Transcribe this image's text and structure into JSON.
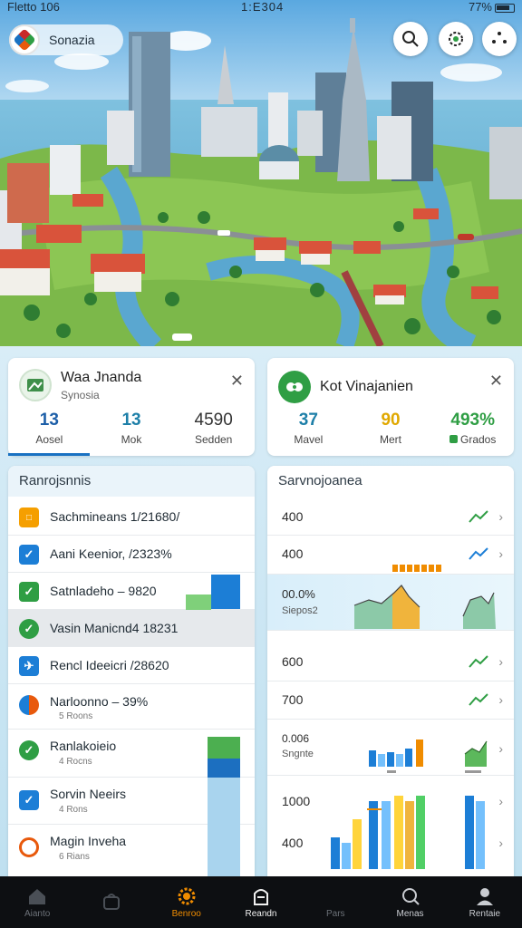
{
  "status_bar": {
    "left": "Fletto 106",
    "center": "1:E304",
    "right": "77%"
  },
  "app": {
    "title": "Sonazia",
    "logo_icon": "app-logo-icon"
  },
  "top_buttons": [
    {
      "name": "search-button",
      "icon": "search-icon"
    },
    {
      "name": "settings-button",
      "icon": "gear-icon"
    },
    {
      "name": "more-button",
      "icon": "dots-icon"
    }
  ],
  "card_left": {
    "name": "Waa Jnanda",
    "sub": "Synosia",
    "stats": [
      {
        "value": "13",
        "label": "Aosel",
        "color": "#1d5fa8"
      },
      {
        "value": "13",
        "label": "Mok",
        "color": "#1d7fa8"
      },
      {
        "value": "4590",
        "label": "Sedden",
        "color": "#333333"
      }
    ]
  },
  "card_right": {
    "name": "Kot Vinajanien",
    "stats": [
      {
        "value": "37",
        "label": "Mavel",
        "color": "#1d7fa8"
      },
      {
        "value": "90",
        "label": "Mert",
        "color": "#e0a800"
      },
      {
        "value": "493%",
        "label": "Grados",
        "color": "#2f9e44"
      }
    ]
  },
  "list_left": {
    "header": "Ranrojsnnis",
    "items": [
      {
        "text": "Sachmineans 1/21680/",
        "sub": "",
        "icon": "folder-icon",
        "color": "#f59f00"
      },
      {
        "text": "Aani Keenior, /2323%",
        "sub": "",
        "icon": "check-icon",
        "color": "#1c7ed6"
      },
      {
        "text": "Satnladeho – 9820",
        "sub": "",
        "icon": "check-icon",
        "color": "#2f9e44"
      },
      {
        "text": "Vasin Manicnd4 18231",
        "sub": "",
        "icon": "check-badge-icon",
        "color": "#2f9e44"
      },
      {
        "text": "Rencl Ideeicri /28620",
        "sub": "",
        "icon": "plane-icon",
        "color": "#1c7ed6"
      },
      {
        "text": "Narloonno – 39%",
        "sub": "5 Roons",
        "icon": "globe-icon",
        "color": "#e8590c"
      },
      {
        "text": "Ranlakoieio",
        "sub": "4 Rocns",
        "icon": "check-badge-icon",
        "color": "#2f9e44"
      },
      {
        "text": "Sorvin Neeirs",
        "sub": "4 Rons",
        "icon": "check-icon",
        "color": "#1c7ed6"
      },
      {
        "text": "Magin Inveha",
        "sub": "6 Rians",
        "icon": "circle-icon",
        "color": "#e8590c"
      }
    ]
  },
  "list_right": {
    "header": "Sarvnojoanea",
    "rows": [
      {
        "value": "400",
        "trend": "up"
      },
      {
        "value": "400",
        "trend": "up"
      },
      {
        "value": "600",
        "trend": "up"
      },
      {
        "value": "700",
        "trend": "up"
      },
      {
        "value": "1000",
        "trend": "none"
      },
      {
        "value": "400",
        "trend": "none"
      }
    ],
    "highlight": {
      "value": "00.0%",
      "sub": "Siepos2"
    },
    "chart_block": {
      "value": "0.006",
      "sub": "Sngnte"
    }
  },
  "bottom_nav": [
    {
      "label": "Aianto",
      "icon": "home-icon"
    },
    {
      "label": "",
      "icon": "bag-icon"
    },
    {
      "label": "Benroo",
      "icon": "gear-orange-icon"
    },
    {
      "label": "Reandn",
      "icon": "doc-icon"
    },
    {
      "label": "Pars",
      "icon": "blank-icon"
    },
    {
      "label": "Menas",
      "icon": "chat-icon"
    },
    {
      "label": "Rentaie",
      "icon": "person-icon"
    }
  ],
  "colors": {
    "accent": "#1971c2",
    "green": "#2f9e44",
    "orange": "#f08c00"
  }
}
